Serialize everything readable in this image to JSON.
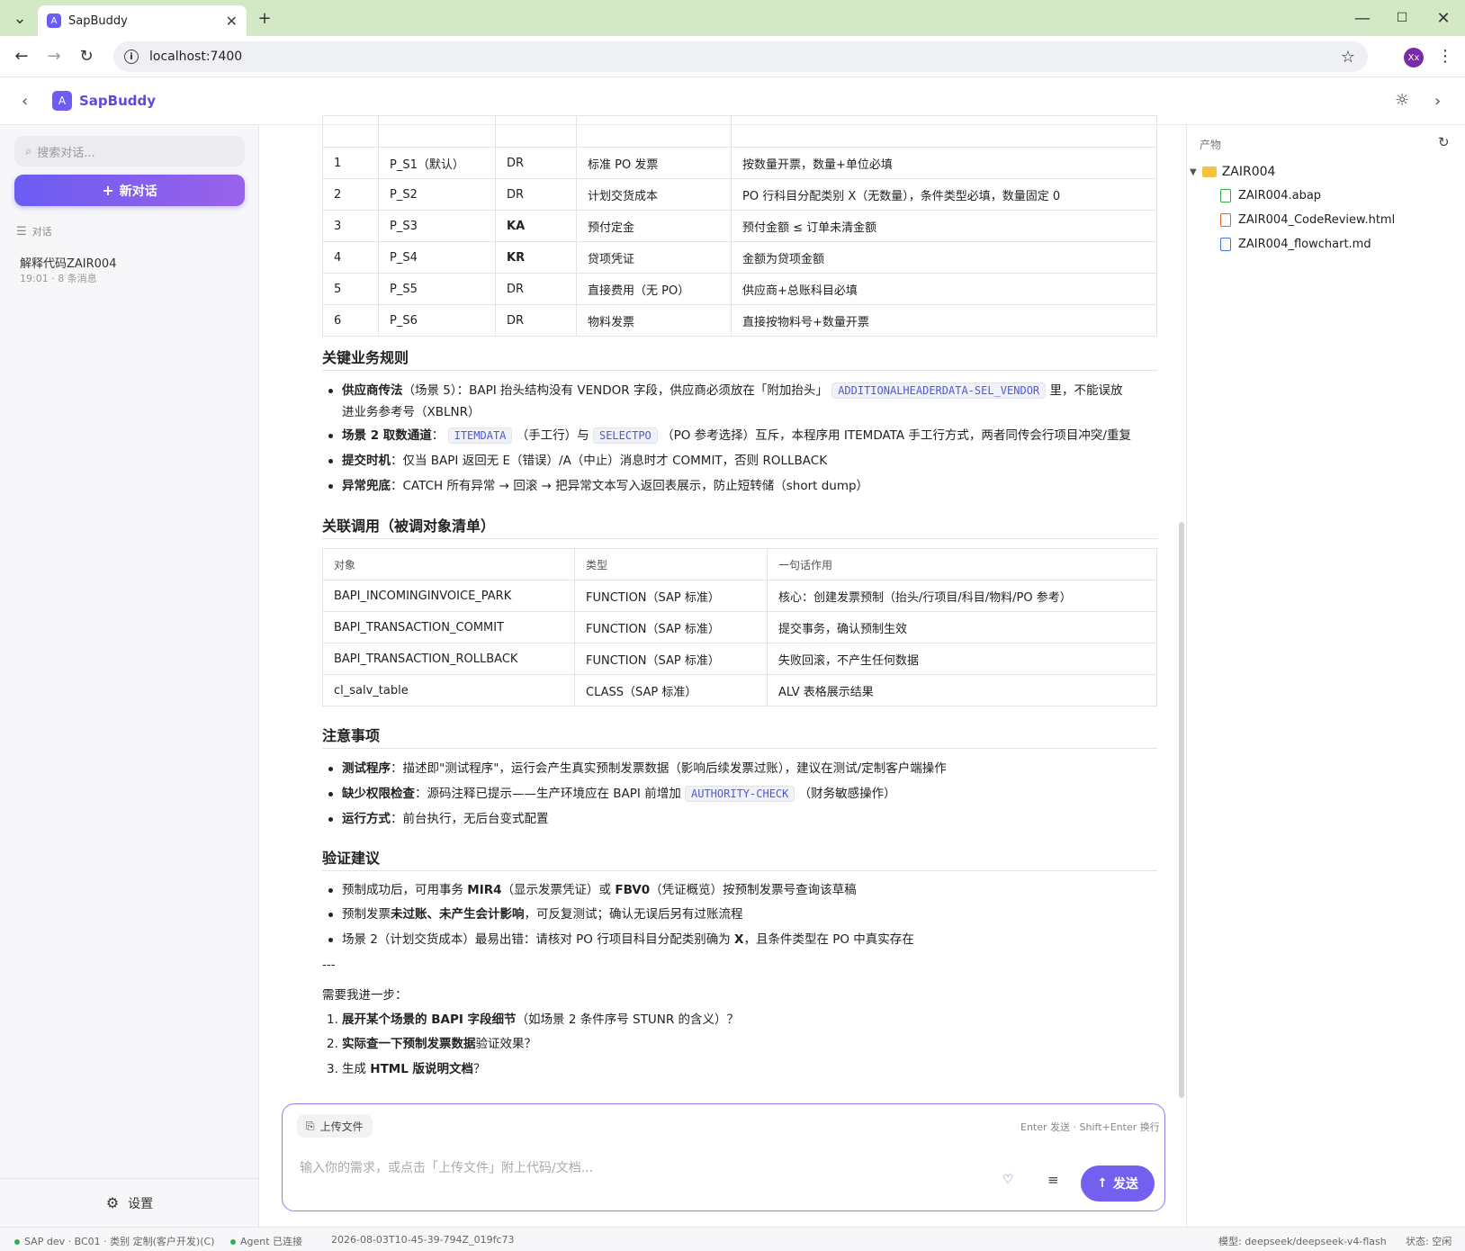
{
  "browser": {
    "tab_title": "SapBuddy",
    "tab_favicon": "A",
    "url": "localhost:7400",
    "profile": "Xx"
  },
  "header": {
    "brand": "SapBuddy",
    "logo_letter": "A"
  },
  "sidebar": {
    "search_placeholder": "搜索对话...",
    "new_chat": "新对话",
    "section": "对话",
    "conversations": [
      {
        "title": "解释代码ZAIR004",
        "meta": "19:01 · 8 条消息"
      }
    ],
    "settings": "设置"
  },
  "main": {
    "table1": {
      "rows": [
        [
          "1",
          "P_S1（默认）",
          "DR",
          "标准 PO 发票",
          "按数量开票，数量+单位必填"
        ],
        [
          "2",
          "P_S2",
          "DR",
          "计划交货成本",
          "PO 行科目分配类别 X（无数量），条件类型必填，数量固定 0"
        ],
        [
          "3",
          "P_S3",
          "KA",
          "预付定金",
          "预付金额 ≤ 订单未清金额"
        ],
        [
          "4",
          "P_S4",
          "KR",
          "贷项凭证",
          "金额为贷项金额"
        ],
        [
          "5",
          "P_S5",
          "DR",
          "直接费用（无 PO）",
          "供应商+总账科目必填"
        ],
        [
          "6",
          "P_S6",
          "DR",
          "物料发票",
          "直接按物料号+数量开票"
        ]
      ]
    },
    "sec_rules": "关键业务规则",
    "rules": [
      {
        "bold": "供应商传法",
        "a": "（场景 5）：BAPI 抬头结构没有 VENDOR 字段，供应商必须放在「附加抬头」",
        "code": "ADDITIONALHEADERDATA-SEL_VENDOR",
        "b": "里，不能误放",
        "c": "进业务参考号（XBLNR）"
      },
      {
        "bold": "场景 2 取数通道",
        "a": "：",
        "code1": "ITEMDATA",
        "b": "（手工行）与",
        "code2": "SELECTPO",
        "c": "（PO 参考选择）互斥，本程序用 ITEMDATA 手工行方式，两者同传会行项目冲突/重复"
      },
      {
        "bold": "提交时机",
        "a": "：仅当 BAPI 返回无 E（错误）/A（中止）消息时才 COMMIT，否则 ROLLBACK"
      },
      {
        "bold": "异常兜底",
        "a": "：CATCH 所有异常 → 回滚 → 把异常文本写入返回表展示，防止短转储（short dump）"
      }
    ],
    "sec_calls": "关联调用（被调对象清单）",
    "table2": {
      "headers": [
        "对象",
        "类型",
        "一句话作用"
      ],
      "rows": [
        [
          "BAPI_INCOMINGINVOICE_PARK",
          "FUNCTION（SAP 标准）",
          "核心：创建发票预制（抬头/行项目/科目/物料/PO 参考）"
        ],
        [
          "BAPI_TRANSACTION_COMMIT",
          "FUNCTION（SAP 标准）",
          "提交事务，确认预制生效"
        ],
        [
          "BAPI_TRANSACTION_ROLLBACK",
          "FUNCTION（SAP 标准）",
          "失败回滚，不产生任何数据"
        ],
        [
          "cl_salv_table",
          "CLASS（SAP 标准）",
          "ALV 表格展示结果"
        ]
      ]
    },
    "sec_notes": "注意事项",
    "notes": [
      {
        "bold": "测试程序",
        "a": "：描述即\"测试程序\"，运行会产生真实预制发票数据（影响后续发票过账），建议在测试/定制客户端操作"
      },
      {
        "bold": "缺少权限检查",
        "a": "：源码注释已提示——生产环境应在 BAPI 前增加",
        "code": "AUTHORITY-CHECK",
        "b": "（财务敏感操作）"
      },
      {
        "bold": "运行方式",
        "a": "：前台执行，无后台变式配置"
      }
    ],
    "sec_verify": "验证建议",
    "verify": [
      {
        "a": "预制成功后，可用事务 ",
        "b1": "MIR4",
        "b": "（显示发票凭证）或 ",
        "b2": "FBV0",
        "c": "（凭证概览）按预制发票号查询该草稿"
      },
      {
        "a": "预制发票",
        "b1": "未过账、未产生会计影响",
        "b": "，可反复测试；确认无误后另有过账流程"
      },
      {
        "a": "场景 2（计划交货成本）最易出错：请核对 PO 行项目科目分配类别确为 ",
        "b1": "X",
        "b": "，且条件类型在 PO 中真实存在"
      }
    ],
    "divider": "---",
    "next_prompt": "需要我进一步：",
    "next": [
      {
        "n": "1.",
        "bold": "展开某个场景的 BAPI 字段细节",
        "a": "（如场景 2 条件序号 STUNR 的含义）？"
      },
      {
        "n": "2.",
        "bold": "实际查一下预制发票数据",
        "a": "验证效果？"
      },
      {
        "n": "3.",
        "a0": "生成 ",
        "bold": "HTML 版说明文档",
        "a": "？"
      }
    ]
  },
  "composer": {
    "upload": "上传文件",
    "hint": "Enter 发送 · Shift+Enter 换行",
    "placeholder": "输入你的需求，或点击「上传文件」附上代码/文档...",
    "send": "发送"
  },
  "artifacts": {
    "label": "产物",
    "folder": "ZAIR004",
    "files": [
      {
        "name": "ZAIR004.abap",
        "color": "#2fa84f"
      },
      {
        "name": "ZAIR004_CodeReview.html",
        "color": "#e8602c"
      },
      {
        "name": "ZAIR004_flowchart.md",
        "color": "#4a6fe0"
      }
    ]
  },
  "status": {
    "sap": "SAP dev · BC01 · 类别 定制(客户开发)(C)",
    "agent": "Agent 已连接",
    "session": "2026-08-03T10-45-39-794Z_019fc73",
    "model": "模型: deepseek/deepseek-v4-flash",
    "state": "状态: 空闲"
  }
}
